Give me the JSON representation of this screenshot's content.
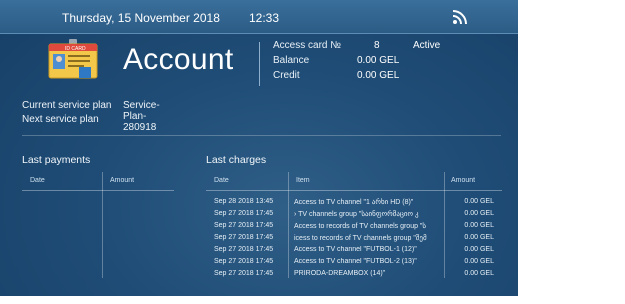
{
  "status_bar": {
    "date": "Thursday, 15 November 2018",
    "time": "12:33",
    "icon": "rss-icon"
  },
  "header": {
    "title": "Account",
    "card_icon": "id-card-icon",
    "card_label": "ID CARD",
    "access_card_label": "Access card №",
    "access_card_number": "8",
    "access_status": "Active",
    "balance_label": "Balance",
    "balance_value": "0.00 GEL",
    "credit_label": "Credit",
    "credit_value": "0.00 GEL"
  },
  "plan": {
    "current_label": "Current service plan",
    "current_value": "Service-Plan-280918",
    "next_label": "Next service plan"
  },
  "last_payments": {
    "title": "Last payments",
    "columns": [
      "Date",
      "Amount"
    ]
  },
  "last_charges": {
    "title": "Last charges",
    "columns": [
      "Date",
      "Item",
      "Amount"
    ],
    "rows": [
      {
        "date": "Sep 28 2018 13:45",
        "item": "Access to TV channel \"1 არხი HD (8)\"",
        "amount": "0.00 GEL"
      },
      {
        "date": "Sep 27 2018 17:45",
        "item": "› TV channels group \"საინფორმაციო კ",
        "amount": "0.00 GEL"
      },
      {
        "date": "Sep 27 2018 17:45",
        "item": "Access to records of TV channels group \"ს",
        "amount": "0.00 GEL"
      },
      {
        "date": "Sep 27 2018 17:45",
        "item": "icess to records of TV channels group \"შემ",
        "amount": "0.00 GEL"
      },
      {
        "date": "Sep 27 2018 17:45",
        "item": "Access to TV channel \"FUTBOL-1 (12)\"",
        "amount": "0.00 GEL"
      },
      {
        "date": "Sep 27 2018 17:45",
        "item": "Access to TV channel \"FUTBOL-2 (13)\"",
        "amount": "0.00 GEL"
      },
      {
        "date": "Sep 27 2018 17:45",
        "item": "PRIRODA-DREAMBOX (14)\"",
        "amount": "0.00 GEL"
      }
    ]
  },
  "colors": {
    "background": "#1f4d77",
    "topbar": "#2b5c86",
    "text": "#ffffff"
  }
}
